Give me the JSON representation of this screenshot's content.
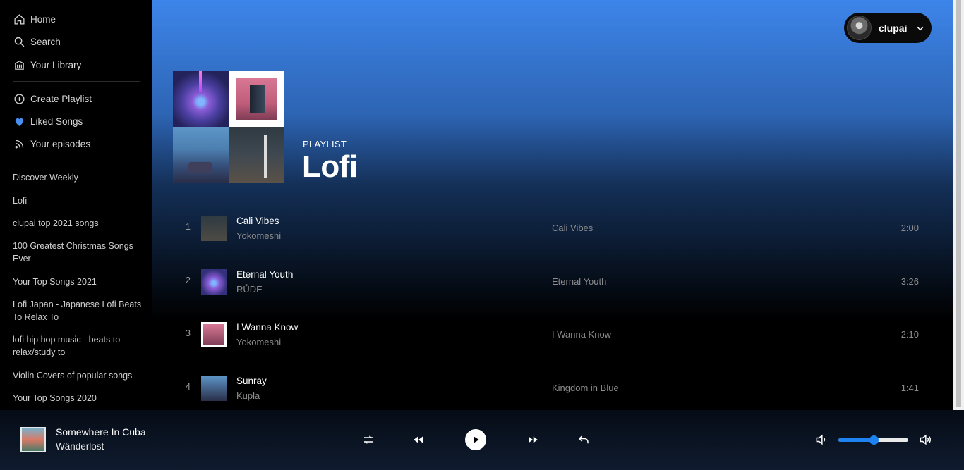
{
  "sidebar": {
    "nav": [
      {
        "label": "Home",
        "icon": "home-icon"
      },
      {
        "label": "Search",
        "icon": "search-icon"
      },
      {
        "label": "Your Library",
        "icon": "library-icon"
      }
    ],
    "actions": [
      {
        "label": "Create Playlist",
        "icon": "plus-circle-icon"
      },
      {
        "label": "Liked Songs",
        "icon": "heart-icon"
      },
      {
        "label": "Your episodes",
        "icon": "rss-icon"
      }
    ],
    "playlists": [
      "Discover Weekly",
      "Lofi",
      "clupai top 2021 songs",
      "100 Greatest Christmas Songs Ever",
      "Your Top Songs 2021",
      "Lofi Japan - Japanese Lofi Beats To Relax To",
      "lofi hip hop music - beats to relax/study to",
      "Violin Covers of popular songs",
      "Your Top Songs 2020"
    ]
  },
  "user": {
    "name": "clupai"
  },
  "playlist": {
    "type": "PLAYLIST",
    "title": "Lofi"
  },
  "tracks": [
    {
      "num": "1",
      "name": "Cali Vibes",
      "artist": "Yokomeshi",
      "album": "Cali Vibes",
      "duration": "2:00"
    },
    {
      "num": "2",
      "name": "Eternal Youth",
      "artist": "RŮDE",
      "album": "Eternal Youth",
      "duration": "3:26"
    },
    {
      "num": "3",
      "name": "I Wanna Know",
      "artist": "Yokomeshi",
      "album": "I Wanna Know",
      "duration": "2:10"
    },
    {
      "num": "4",
      "name": "Sunray",
      "artist": "Kupla",
      "album": "Kingdom in Blue",
      "duration": "1:41"
    }
  ],
  "player": {
    "track": "Somewhere In Cuba",
    "artist": "Wänderlost",
    "volume": 0.5,
    "accent": "#1e82f0"
  },
  "colors": {
    "gradient_top": "#3d85ea",
    "background": "#000000"
  }
}
